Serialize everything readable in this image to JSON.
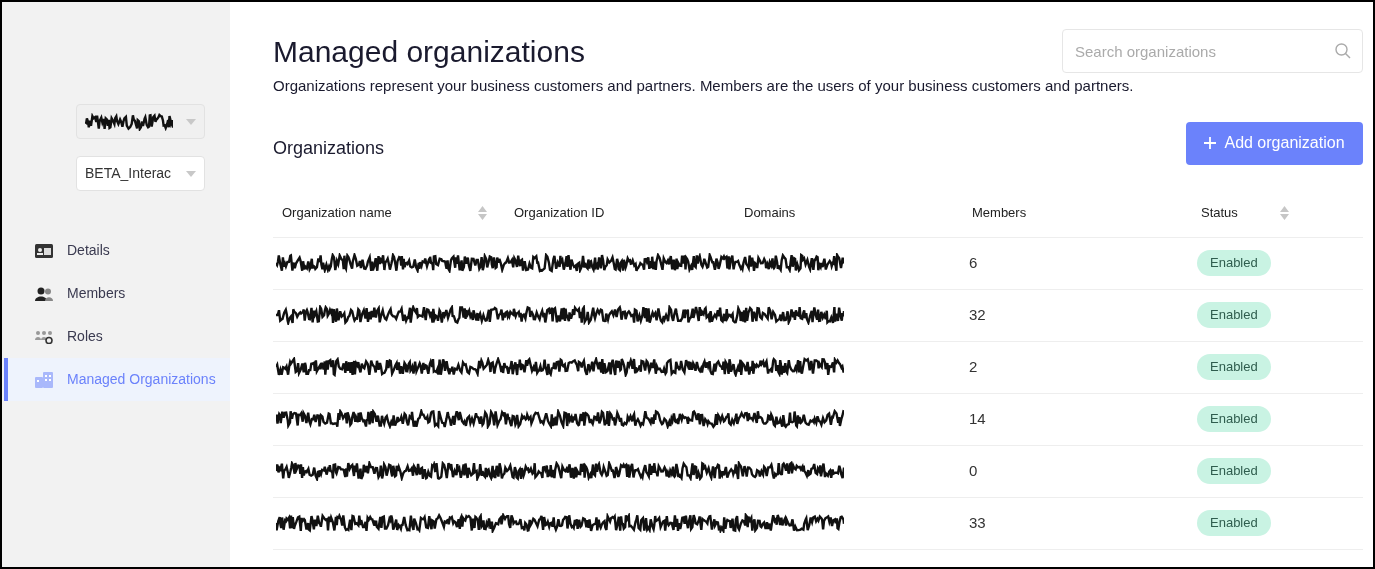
{
  "sidebar": {
    "selectors": [
      {
        "redacted": true
      },
      {
        "value": "BETA_Interac",
        "redacted": false
      }
    ],
    "items": [
      {
        "label": "Details",
        "selected": false
      },
      {
        "label": "Members",
        "selected": false
      },
      {
        "label": "Roles",
        "selected": false
      },
      {
        "label": "Managed Organizations",
        "selected": true
      }
    ]
  },
  "page": {
    "title": "Managed organizations",
    "description": "Organizations represent your business customers and partners. Members are the users of your business customers and partners.",
    "search": {
      "placeholder": "Search organizations"
    }
  },
  "section": {
    "title": "Organizations",
    "add_button": "Add organization"
  },
  "table": {
    "columns": [
      {
        "label": "Organization name",
        "sortable": true
      },
      {
        "label": "Organization ID",
        "sortable": false
      },
      {
        "label": "Domains",
        "sortable": false
      },
      {
        "label": "Members",
        "sortable": false
      },
      {
        "label": "Status",
        "sortable": true
      }
    ],
    "rows": [
      {
        "redacted": true,
        "members": "6",
        "status": "Enabled"
      },
      {
        "redacted": true,
        "members": "32",
        "status": "Enabled"
      },
      {
        "redacted": true,
        "members": "2",
        "status": "Enabled"
      },
      {
        "redacted": true,
        "members": "14",
        "status": "Enabled"
      },
      {
        "redacted": true,
        "members": "0",
        "status": "Enabled"
      },
      {
        "redacted": true,
        "members": "33",
        "status": "Enabled"
      }
    ]
  }
}
